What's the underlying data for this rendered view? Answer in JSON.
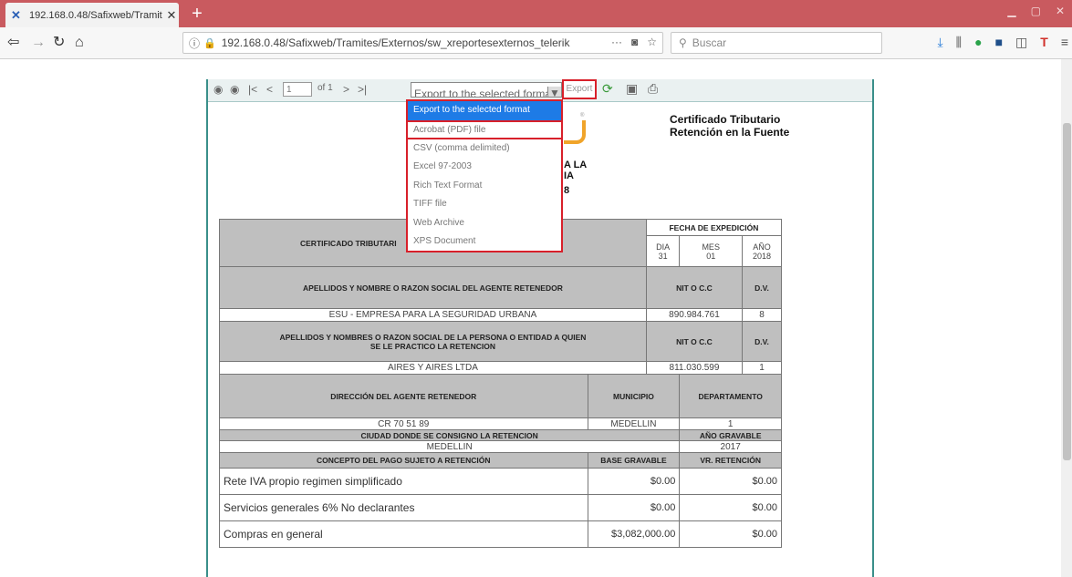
{
  "browser": {
    "tab_title": "192.168.0.48/Safixweb/Tramit",
    "url": "192.168.0.48/Safixweb/Tramites/Externos/sw_xreportesexternos_telerik",
    "search_placeholder": "Buscar"
  },
  "report_toolbar": {
    "page_current": "1",
    "page_of": "of 1",
    "format_selected": "Export to the selected format",
    "export_label": "Export"
  },
  "export_menu": {
    "items": [
      "Export to the selected format",
      "Acrobat (PDF) file",
      "CSV (comma delimited)",
      "Excel 97-2003",
      "Rich Text Format",
      "TIFF file",
      "Web Archive",
      "XPS Document"
    ]
  },
  "certificate": {
    "title": "Certificado Tributario Retención en la Fuente",
    "fragment1": "A LA",
    "fragment2": "IA",
    "fragment3": "8",
    "header_left": "CERTIFICADO TRIBUTARI",
    "fecha_label": "FECHA DE EXPEDICIÓN",
    "dia_label": "DIA",
    "mes_label": "MES",
    "ano_label": "AÑO",
    "dia": "31",
    "mes": "01",
    "ano": "2018",
    "agente_label": "APELLIDOS Y NOMBRE O RAZON SOCIAL DEL AGENTE RETENEDOR",
    "nit_label": "NIT O C.C",
    "dv_label": "D.V.",
    "agente": "ESU - EMPRESA PARA LA SEGURIDAD URBANA",
    "agente_nit": "890.984.761",
    "agente_dv": "8",
    "persona_label": "APELLIDOS Y NOMBRES O RAZON SOCIAL DE LA PERSONA O ENTIDAD A QUIEN SE LE PRACTICO LA RETENCION",
    "persona": "AIRES Y AIRES LTDA",
    "persona_nit": "811.030.599",
    "persona_dv": "1",
    "direccion_label": "DIRECCIÓN DEL AGENTE RETENEDOR",
    "municipio_label": "MUNICIPIO",
    "departamento_label": "DEPARTAMENTO",
    "direccion": "CR 70 51 89",
    "municipio": "MEDELLIN",
    "departamento": "1",
    "ciudad_label": "CIUDAD DONDE SE CONSIGNO LA RETENCION",
    "ano_gravable_label": "AÑO GRAVABLE",
    "ciudad": "MEDELLIN",
    "ano_gravable": "2017",
    "concepto_label": "CONCEPTO DEL PAGO SUJETO A RETENCIÓN",
    "base_label": "BASE GRAVABLE",
    "vr_label": "VR. RETENCIÓN",
    "rows": [
      {
        "concepto": "Rete IVA propio regimen simplificado",
        "base": "$0.00",
        "vr": "$0.00"
      },
      {
        "concepto": "Servicios generales 6% No declarantes",
        "base": "$0.00",
        "vr": "$0.00"
      },
      {
        "concepto": "Compras en general",
        "base": "$3,082,000.00",
        "vr": "$0.00"
      }
    ]
  }
}
